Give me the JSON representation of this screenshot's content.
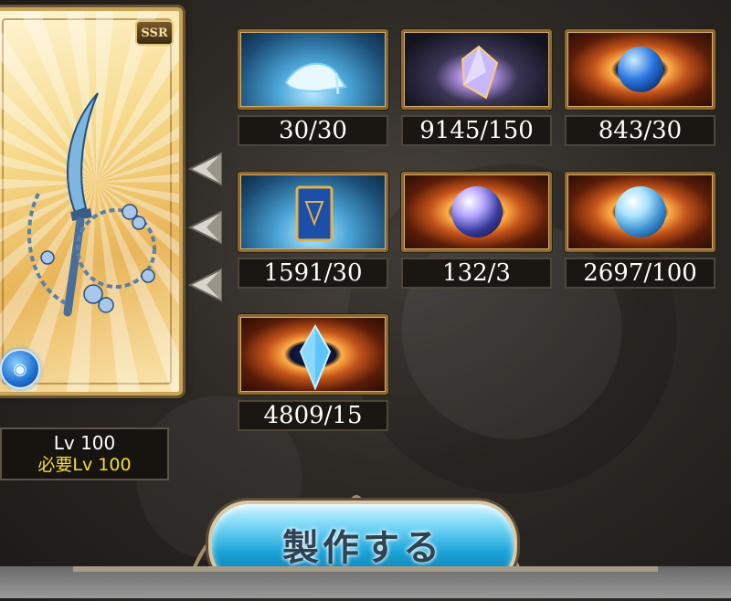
{
  "weapon": {
    "rarity": "SSR",
    "element_icon": "water-element-icon",
    "level_label": "Lv 100",
    "required_level_label": "必要Lv 100"
  },
  "arrows": [
    "arrow-left-icon",
    "arrow-left-icon",
    "arrow-left-icon"
  ],
  "materials": [
    {
      "icon": "glass-slipper-icon",
      "count": "30/30"
    },
    {
      "icon": "crystal-shard-icon",
      "count": "9145/150"
    },
    {
      "icon": "blue-orb-icon",
      "count": "843/30"
    },
    {
      "icon": "blue-tome-icon",
      "count": "1591/30"
    },
    {
      "icon": "prism-orb-icon",
      "count": "132/3"
    },
    {
      "icon": "water-orb-icon",
      "count": "2697/100"
    },
    {
      "icon": "blue-crystal-icon",
      "count": "4809/15"
    }
  ],
  "craft_button_label": "製作する",
  "colors": {
    "required_level": "#f3dd3c",
    "button": "#1aa3d8",
    "frame_gold": "#c9a35a"
  }
}
